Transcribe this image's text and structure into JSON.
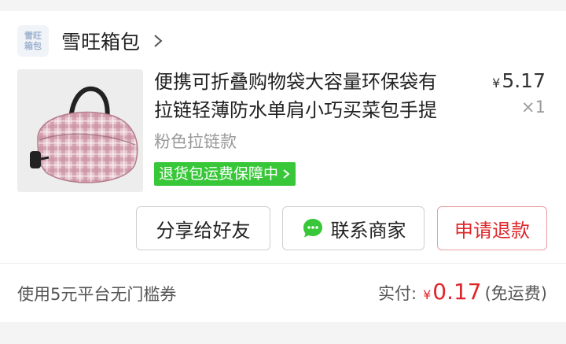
{
  "shop": {
    "logo_line1": "雪旺",
    "logo_line2": "箱包",
    "name": "雪旺箱包"
  },
  "product": {
    "title_line1": "便携可折叠购物袋大容量环保袋有",
    "title_line2": "拉链轻薄防水单肩小巧买菜包手提",
    "price_symbol": "¥",
    "price": "5.17",
    "quantity": "×1",
    "variant": "粉色拉链款",
    "badge": "退货包运费保障中"
  },
  "actions": {
    "share": "分享给好友",
    "contact": "联系商家",
    "refund": "申请退款"
  },
  "footer": {
    "coupon": "使用5元平台无门槛券",
    "paid_label": "实付:",
    "paid_symbol": "¥",
    "paid_amount": "0.17",
    "shipping": "(免运费)"
  },
  "colors": {
    "accent_red": "#e0262a",
    "badge_green": "#37c738"
  }
}
